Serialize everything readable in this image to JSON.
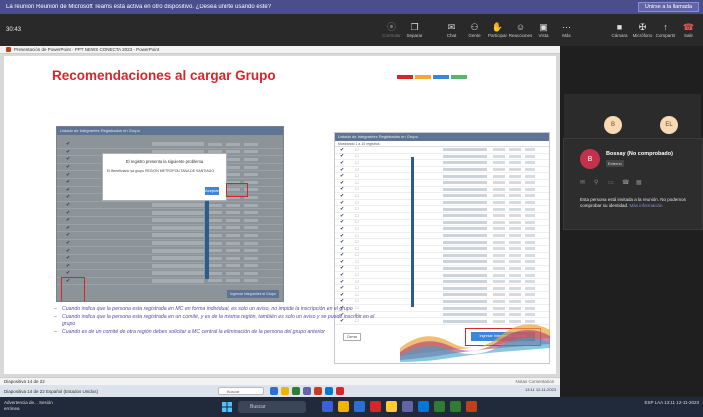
{
  "banner": {
    "message": "La reunión Reunión de Microsoft Teams está activa en otro dispositivo. ¿Desea unirte usando este?",
    "join_label": "Unirse a la llamada"
  },
  "toolbar": {
    "time": "30:43",
    "left_buttons": [
      {
        "label": "Controlar",
        "icon": "control-icon",
        "glyph": "⦿",
        "disabled": true
      },
      {
        "label": "Separar",
        "icon": "separate-icon",
        "glyph": "❐",
        "disabled": false
      }
    ],
    "mid_buttons": [
      {
        "label": "Chat",
        "icon": "chat-icon",
        "glyph": "✉"
      },
      {
        "label": "Gente",
        "icon": "people-icon",
        "glyph": "⚇"
      },
      {
        "label": "Participar",
        "icon": "hand-icon",
        "glyph": "✋"
      },
      {
        "label": "Reacciones",
        "icon": "smiley-icon",
        "glyph": "☺"
      },
      {
        "label": "Vista",
        "icon": "view-icon",
        "glyph": "▣"
      },
      {
        "label": "Más",
        "icon": "more-icon",
        "glyph": "⋯"
      }
    ],
    "right_buttons": [
      {
        "label": "Cámara",
        "icon": "camera-icon",
        "glyph": "■"
      },
      {
        "label": "Micrófono",
        "icon": "microphone-icon",
        "glyph": "✠"
      },
      {
        "label": "Compartir",
        "icon": "share-icon",
        "glyph": "↑"
      },
      {
        "label": "Salir",
        "icon": "leave-icon",
        "glyph": "☎"
      }
    ]
  },
  "ppt": {
    "window_title": "Presentación de PowerPoint - PPT NEWS CONECTA 2023 - PowerPoint",
    "status_left": "Diapositiva 14 de 22",
    "status_right": "Notas   Comentarios",
    "taskbar_left": "Diapositiva 14 de 22   Español (Estados Unidos)",
    "taskbar_search": "Buscar",
    "taskbar_tray": "13:11  12-11-2023"
  },
  "slide": {
    "title": "Recomendaciones al cargar Grupo",
    "shot1": {
      "header": "Listado de Integrantes Registrados en Grupo",
      "dialog_title": "El registro presenta la siguiente problema",
      "dialog_message": "El Beneficiario ya grupo REGION METROPOLITANA DE SANTIAGO",
      "dialog_ok": "Aceptar",
      "footer_button": "Ingresar Integrantes al Grupo"
    },
    "shot2": {
      "header": "Listado de Integrantes Registrados en Grupo",
      "subheader": "Mostrando 1 a 10 registros",
      "cancel_label": "Cerrar",
      "add_label": "Ingresar Integrantes al Grupo"
    },
    "bullets": [
      "Cuando indica que la persona esta registrada en MC en forma individual, es  solo un aviso, no impide la inscripción en el grupo",
      "Cuando indica que la persona esta registrada en un comité, y es de la misma región, también es solo un aviso y se puede inscribir en el grupo",
      "Cuando es de un comité de otra región debes solicitar a MC central la eliminación de la persona del grupo anterior"
    ]
  },
  "participants": {
    "tile_avatars": [
      "B",
      "EL"
    ],
    "popup": {
      "avatar": "B",
      "name": "Bossay (No comprobado)",
      "tag": "Externo",
      "info": "Esta persona está invitada a la reunión. No podemos comprobar su identidad.",
      "info_link": "Más información"
    }
  },
  "taskbar": {
    "warning": "Advertencia de... Sesión errónea",
    "search": "Buscar",
    "tray": "ESP LAA   13:11   12-11-2023"
  },
  "colors": {
    "slide_title": "#d6262b",
    "bullet_text": "#5a4a9e",
    "teams_banner": "#4a4f8c",
    "highlight_box": "#d6262b"
  }
}
